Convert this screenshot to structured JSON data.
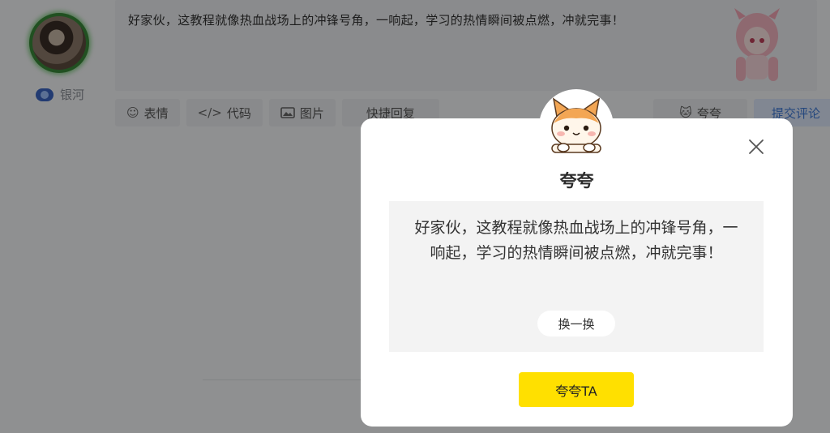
{
  "user": {
    "name": "银河"
  },
  "editor": {
    "content": "好家伙，这教程就像热血战场上的冲锋号角，一响起，学习的热情瞬间被点燃，冲就完事！"
  },
  "toolbar": {
    "emoji_label": "表情",
    "code_label": "代码",
    "image_label": "图片",
    "quick_reply_label": "快捷回复",
    "praise_label": "夸夸",
    "submit_label": "提交评论"
  },
  "icons": [
    "smile-icon",
    "code-icon",
    "image-icon",
    "cat-icon",
    "close-icon"
  ],
  "modal": {
    "title": "夸夸",
    "message": "好家伙，这教程就像热血战场上的冲锋号角，一响起，学习的热情瞬间被点燃，冲就完事！",
    "swap_label": "换一换",
    "praise_button_label": "夸夸TA"
  },
  "colors": {
    "praise_button": "#ffe000",
    "submit_text": "#3f7ad8",
    "avatar_ring": "#3a8a3a"
  }
}
